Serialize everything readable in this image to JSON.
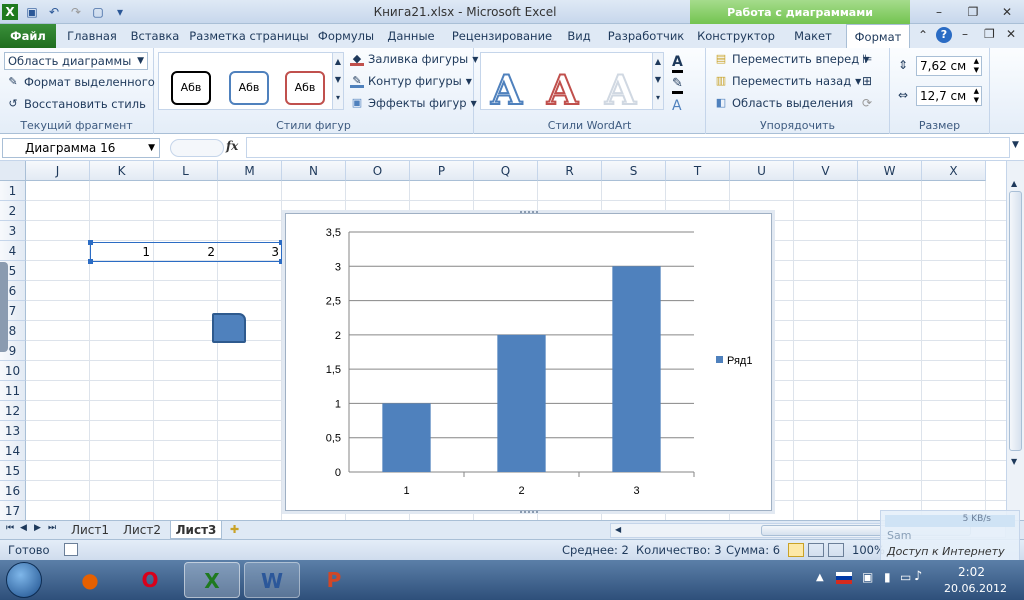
{
  "title_bar": {
    "title": "Книга21.xlsx - Microsoft Excel",
    "context_group": "Работа с диаграммами"
  },
  "ribbon_tabs": [
    "Файл",
    "Главная",
    "Вставка",
    "Разметка страницы",
    "Формулы",
    "Данные",
    "Рецензирование",
    "Вид",
    "Разработчик",
    "Конструктор",
    "Макет",
    "Формат"
  ],
  "active_tab": "Формат",
  "ribbon": {
    "current_selection": {
      "dropdown": "Область диаграммы",
      "format_selection": "Формат выделенного",
      "reset_style": "Восстановить стиль",
      "label": "Текущий фрагмент"
    },
    "shape_styles": {
      "sample": "Абв",
      "fill": "Заливка фигуры",
      "outline": "Контур фигуры",
      "effects": "Эффекты фигур",
      "label": "Стили фигур"
    },
    "wordart": {
      "glyph": "A",
      "label": "Стили WordArt"
    },
    "arrange": {
      "bring_forward": "Переместить вперед",
      "send_backward": "Переместить назад",
      "selection_pane": "Область выделения",
      "label": "Упорядочить"
    },
    "size": {
      "height": "7,62 см",
      "width": "12,7 см",
      "label": "Размер"
    }
  },
  "formula_bar": {
    "name_box": "Диаграмма 16",
    "fx": "fx",
    "formula": ""
  },
  "grid": {
    "columns": [
      "J",
      "K",
      "L",
      "M",
      "N",
      "O",
      "P",
      "Q",
      "R",
      "S",
      "T",
      "U",
      "V",
      "W",
      "X"
    ],
    "rows": [
      "1",
      "2",
      "3",
      "4",
      "5",
      "6",
      "7",
      "8",
      "9",
      "10",
      "11",
      "12",
      "13",
      "14",
      "15",
      "16",
      "17"
    ],
    "row4_values": [
      "1",
      "2",
      "3"
    ]
  },
  "chart_data": {
    "type": "bar",
    "categories": [
      "1",
      "2",
      "3"
    ],
    "series": [
      {
        "name": "Ряд1",
        "values": [
          1,
          2,
          3
        ],
        "color": "#4f81bd"
      }
    ],
    "yticks": [
      "0",
      "0,5",
      "1",
      "1,5",
      "2",
      "2,5",
      "3",
      "3,5"
    ],
    "ylim": [
      0,
      3.5
    ],
    "grid": true,
    "legend": "right"
  },
  "sheet_tabs": [
    "Лист1",
    "Лист2",
    "Лист3"
  ],
  "active_sheet": "Лист3",
  "status_bar": {
    "ready": "Готово",
    "average": "Среднее: 2",
    "count": "Количество: 3",
    "sum": "Сумма: 6",
    "zoom": "100%"
  },
  "network_widget": {
    "speed": "5 KB/s",
    "user": "Sam",
    "status": "Доступ к Интернету"
  },
  "taskbar": {
    "time": "2:02",
    "date": "20.06.2012",
    "apps": [
      "start",
      "firefox",
      "opera",
      "excel",
      "word",
      "powerpoint"
    ]
  },
  "colors": {
    "accent": "#4f81bd",
    "file_tab": "#2a7d2a",
    "context_green": "#79c956"
  }
}
